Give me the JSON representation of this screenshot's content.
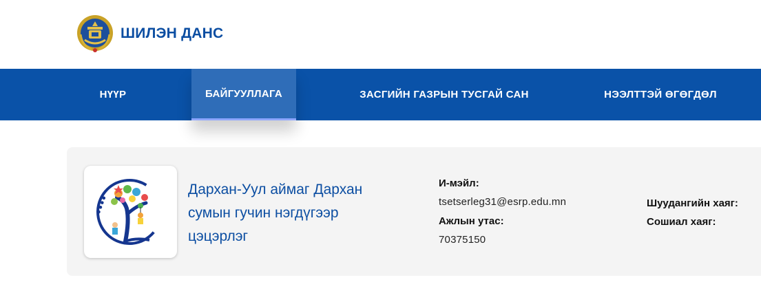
{
  "header": {
    "site_name": "ШИЛЭН ДАНС",
    "emblem_icon": "state-emblem-icon"
  },
  "nav": {
    "items": [
      {
        "label": "НҮҮР",
        "active": false
      },
      {
        "label": "БАЙГУУЛЛАГА",
        "active": true
      },
      {
        "label": "ЗАСГИЙН ГАЗРЫН ТУСГАЙ САН",
        "active": false
      },
      {
        "label": "НЭЭЛТТЭЙ ӨГӨГДӨЛ",
        "active": false
      }
    ]
  },
  "organization": {
    "logo_icon": "kindergarten-tree-logo",
    "name": "Дархан-Уул аймаг Дархан сумын гучин нэгдүгээр цэцэрлэг",
    "email_label": "И-мэйл:",
    "email": "tsetserleg31@esrp.edu.mn",
    "phone_label": "Ажлын утас:",
    "phone": "70375150",
    "mail_address_label": "Шуудангийн хаяг:",
    "social_label": "Сошиал хаяг:"
  },
  "colors": {
    "brand_blue": "#0c4ea2",
    "nav_bg": "#0a52a8",
    "nav_active_bg": "#2f6db8",
    "card_bg": "#f4f4f4"
  }
}
